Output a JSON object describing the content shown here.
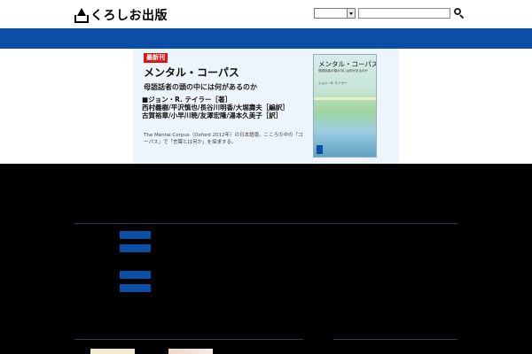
{
  "header": {
    "logo_text": "くろしお出版",
    "search": {
      "select_value": "",
      "input_value": "",
      "input_placeholder": ""
    }
  },
  "nav": {
    "items": [
      {
        "label": ""
      },
      {
        "label": ""
      },
      {
        "label": ""
      },
      {
        "label": ""
      },
      {
        "label": ""
      },
      {
        "label": ""
      },
      {
        "label": ""
      }
    ]
  },
  "hero": {
    "badge": "最新刊",
    "title": "メンタル・コーパス",
    "subtitle": "母語話者の頭の中には何があるのか",
    "authors": [
      "■ジョン・R. テイラー［著］",
      "西村義樹/平沢慎也/長谷川明香/大堀壽夫［編訳］",
      "古賀裕章/小早川暁/友澤宏隆/湯本久美子［訳］"
    ],
    "description": "The Mental Corpus（Oxford 2012年）の日本語版。こころの中の「コーパス」で「言葉とは何か」を探求する。",
    "book": {
      "title": "メンタル・コーパス",
      "subtitle": "母語話者の頭の中には何があるのか",
      "author": "ジョン・R. テイラー"
    }
  },
  "news": {
    "heading": "",
    "rows": [
      {
        "date": "",
        "tag": "",
        "text": ""
      },
      {
        "date": "",
        "tag": "",
        "text": ""
      },
      {
        "date": "",
        "tag": "",
        "text": ""
      },
      {
        "date": "",
        "tag": "",
        "text": ""
      },
      {
        "date": "",
        "tag": "",
        "text": ""
      }
    ]
  },
  "sections": {
    "left_heading": "",
    "right_heading": ""
  },
  "colors": {
    "nav_blue": "#0a4ea6",
    "badge_red": "#d41a1a",
    "page_bg": "#000000",
    "news_link": "#4c7ccf"
  }
}
